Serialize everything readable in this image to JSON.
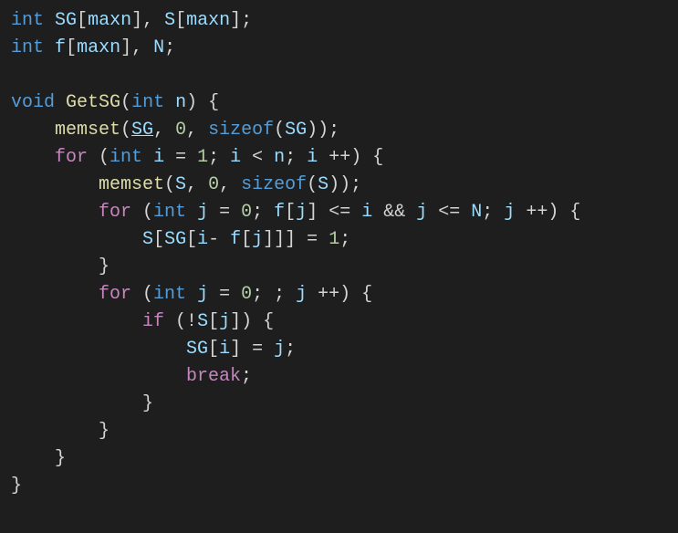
{
  "code": {
    "line1": {
      "int": "int",
      "SG": "SG",
      "maxn1": "maxn",
      "S": "S",
      "maxn2": "maxn"
    },
    "line2": {
      "int": "int",
      "f": "f",
      "maxn": "maxn",
      "N": "N"
    },
    "line4": {
      "void": "void",
      "GetSG": "GetSG",
      "int": "int",
      "n": "n"
    },
    "line5": {
      "memset": "memset",
      "SG": "SG",
      "zero": "0",
      "sizeof": "sizeof",
      "SG2": "SG"
    },
    "line6": {
      "for": "for",
      "int": "int",
      "i": "i",
      "one": "1",
      "i2": "i",
      "n": "n",
      "i3": "i"
    },
    "line7": {
      "memset": "memset",
      "S": "S",
      "zero": "0",
      "sizeof": "sizeof",
      "S2": "S"
    },
    "line8": {
      "for": "for",
      "int": "int",
      "j": "j",
      "zero": "0",
      "f": "f",
      "j2": "j",
      "i": "i",
      "j3": "j",
      "N": "N",
      "j4": "j"
    },
    "line9": {
      "S": "S",
      "SG": "SG",
      "i": "i",
      "f": "f",
      "j": "j",
      "one": "1"
    },
    "line11": {
      "for": "for",
      "int": "int",
      "j": "j",
      "zero": "0",
      "j2": "j"
    },
    "line12": {
      "if": "if",
      "S": "S",
      "j": "j"
    },
    "line13": {
      "SG": "SG",
      "i": "i",
      "j": "j"
    },
    "line14": {
      "break": "break"
    }
  }
}
